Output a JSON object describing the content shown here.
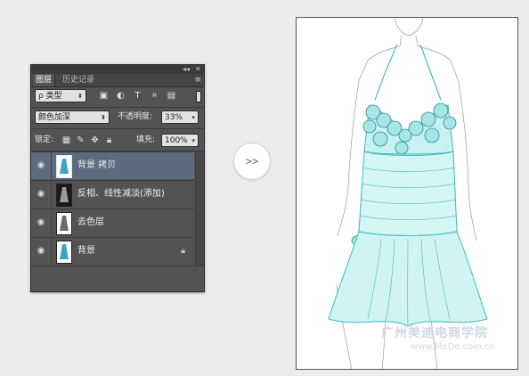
{
  "panel": {
    "tabs": [
      "图层",
      "历史记录"
    ],
    "filter": {
      "label": "ρ 类型"
    },
    "blend_mode": "颜色加深",
    "opacity": {
      "label": "不透明度:",
      "value": "33%"
    },
    "lock_label": "锁定:",
    "fill": {
      "label": "填充:",
      "value": "100%"
    },
    "layers": [
      {
        "name": "背景 拷贝",
        "selected": true,
        "locked": false
      },
      {
        "name": "反相、线性减淡(添加)",
        "selected": false,
        "locked": false
      },
      {
        "name": "去色层",
        "selected": false,
        "locked": false
      },
      {
        "name": "背景",
        "selected": false,
        "locked": true
      }
    ]
  },
  "arrow_button": {
    "label": ">>"
  },
  "preview": {
    "watermark_text": "广州美迪电商学院",
    "watermark_url": "www.MeDe.com.cn"
  },
  "colors": {
    "panel_bg": "#535353",
    "selected_layer": "#5c6b7f",
    "dress_line": "#3fb8b8",
    "dress_fill": "#bff0f0"
  }
}
